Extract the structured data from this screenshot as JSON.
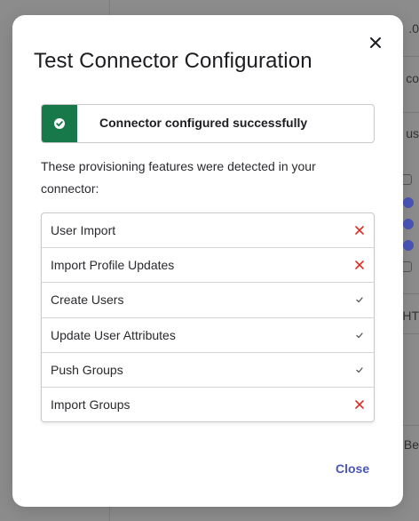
{
  "dialog": {
    "title": "Test Connector Configuration",
    "close_label": "Close"
  },
  "banner": {
    "message": "Connector configured successfully",
    "color": "#17784a"
  },
  "intro_text": "These provisioning features were detected in your connector:",
  "features": [
    {
      "label": "User Import",
      "status": "not-detected",
      "icon": "x-icon"
    },
    {
      "label": "Import Profile Updates",
      "status": "not-detected",
      "icon": "x-icon"
    },
    {
      "label": "Create Users",
      "status": "detected",
      "icon": "check-icon"
    },
    {
      "label": "Update User Attributes",
      "status": "detected",
      "icon": "check-icon"
    },
    {
      "label": "Push Groups",
      "status": "detected",
      "icon": "check-icon"
    },
    {
      "label": "Import Groups",
      "status": "not-detected",
      "icon": "x-icon"
    }
  ],
  "colors": {
    "error": "#d93025",
    "check": "#555555",
    "link": "#4a55b8"
  },
  "background_fragments": [
    ".0",
    "co",
    "us",
    "HT",
    "Be"
  ]
}
